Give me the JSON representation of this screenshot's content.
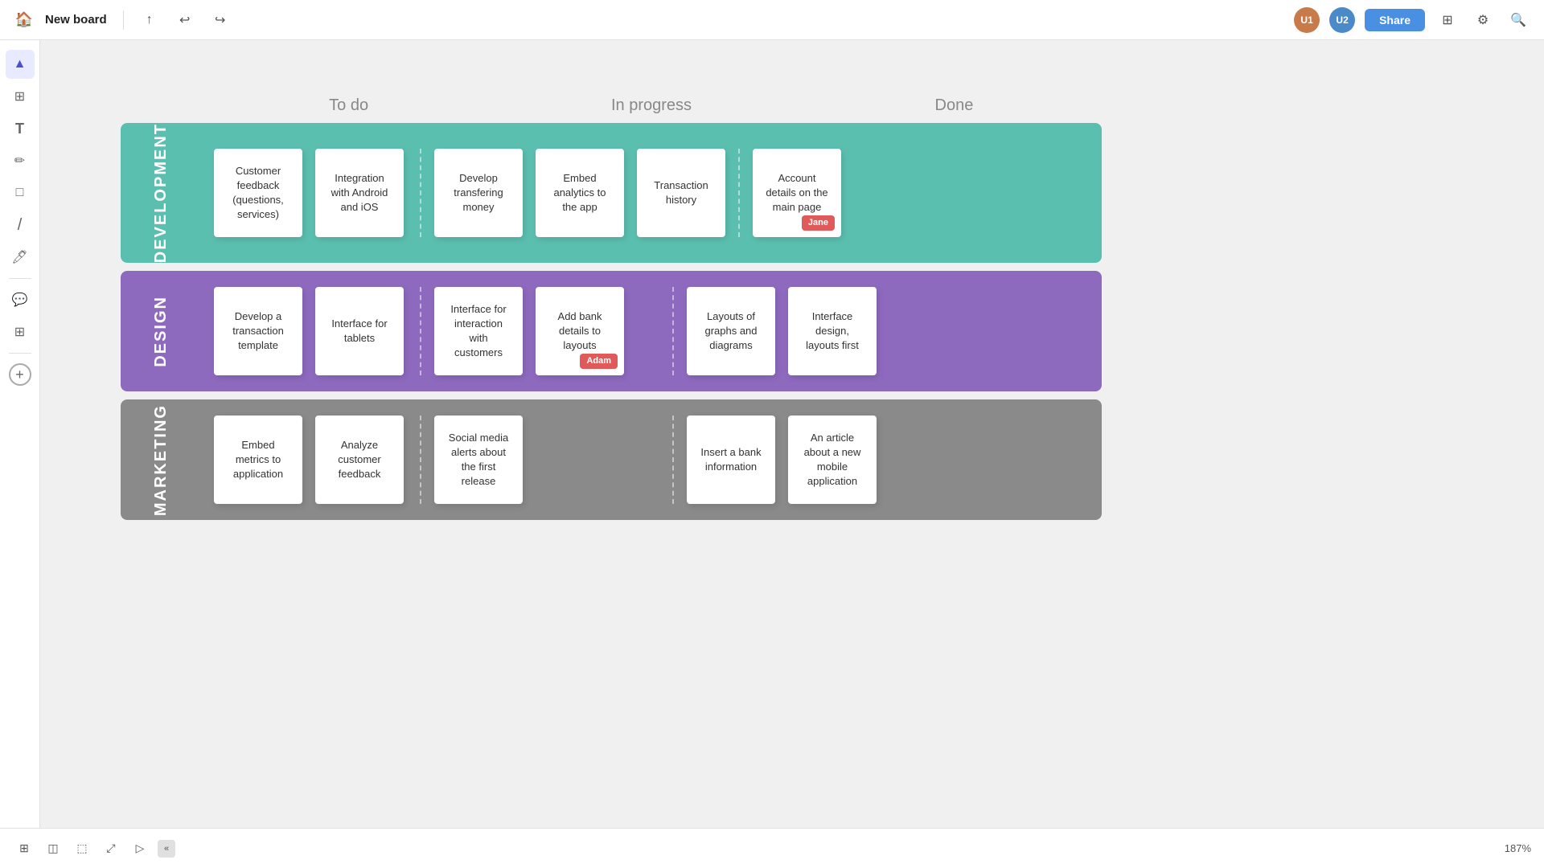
{
  "topbar": {
    "title": "New board",
    "share_label": "Share",
    "zoom_level": "187%"
  },
  "columns": {
    "todo": "To do",
    "inprogress": "In progress",
    "done": "Done"
  },
  "lanes": [
    {
      "id": "development",
      "label": "Development",
      "color_class": "lane-dev",
      "sections": {
        "todo": [
          {
            "text": "Customer feedback (questions, services)"
          },
          {
            "text": "Integration with Android and iOS"
          }
        ],
        "inprogress": [
          {
            "text": "Develop transfering money"
          },
          {
            "text": "Embed analytics to the app"
          },
          {
            "text": "Transaction history"
          }
        ],
        "done": [
          {
            "text": "Account details on the main page",
            "tag": "Jane",
            "tag_class": "tag-jane"
          }
        ]
      }
    },
    {
      "id": "design",
      "label": "Design",
      "color_class": "lane-design",
      "sections": {
        "todo": [
          {
            "text": "Develop a transaction template"
          },
          {
            "text": "Interface for tablets"
          }
        ],
        "inprogress": [
          {
            "text": "Interface for interaction with customers"
          },
          {
            "text": "Add bank details to layouts",
            "tag": "Adam",
            "tag_class": "tag-adam"
          }
        ],
        "done": [
          {
            "text": "Layouts of graphs and diagrams"
          },
          {
            "text": "Interface design, layouts first"
          }
        ]
      }
    },
    {
      "id": "marketing",
      "label": "Marketing",
      "color_class": "lane-marketing",
      "sections": {
        "todo": [
          {
            "text": "Embed metrics to application"
          },
          {
            "text": "Analyze customer feedback"
          }
        ],
        "inprogress": [
          {
            "text": "Social media alerts about the first release"
          }
        ],
        "done": [
          {
            "text": "Insert a bank information"
          },
          {
            "text": "An article about a new mobile application"
          }
        ]
      }
    }
  ],
  "sidebar_tools": [
    {
      "icon": "▲",
      "label": "select-tool",
      "active": true
    },
    {
      "icon": "⊞",
      "label": "frame-tool"
    },
    {
      "icon": "T",
      "label": "text-tool"
    },
    {
      "icon": "✏",
      "label": "pen-tool"
    },
    {
      "icon": "□",
      "label": "shape-tool"
    },
    {
      "icon": "∕",
      "label": "line-tool"
    },
    {
      "icon": "✦",
      "label": "marker-tool"
    },
    {
      "icon": "💬",
      "label": "comment-tool"
    },
    {
      "icon": "⊕",
      "label": "plugin-tool"
    }
  ],
  "bottombar_tools": [
    "grid-view",
    "sticky-note",
    "frame-insert",
    "expand",
    "present"
  ]
}
